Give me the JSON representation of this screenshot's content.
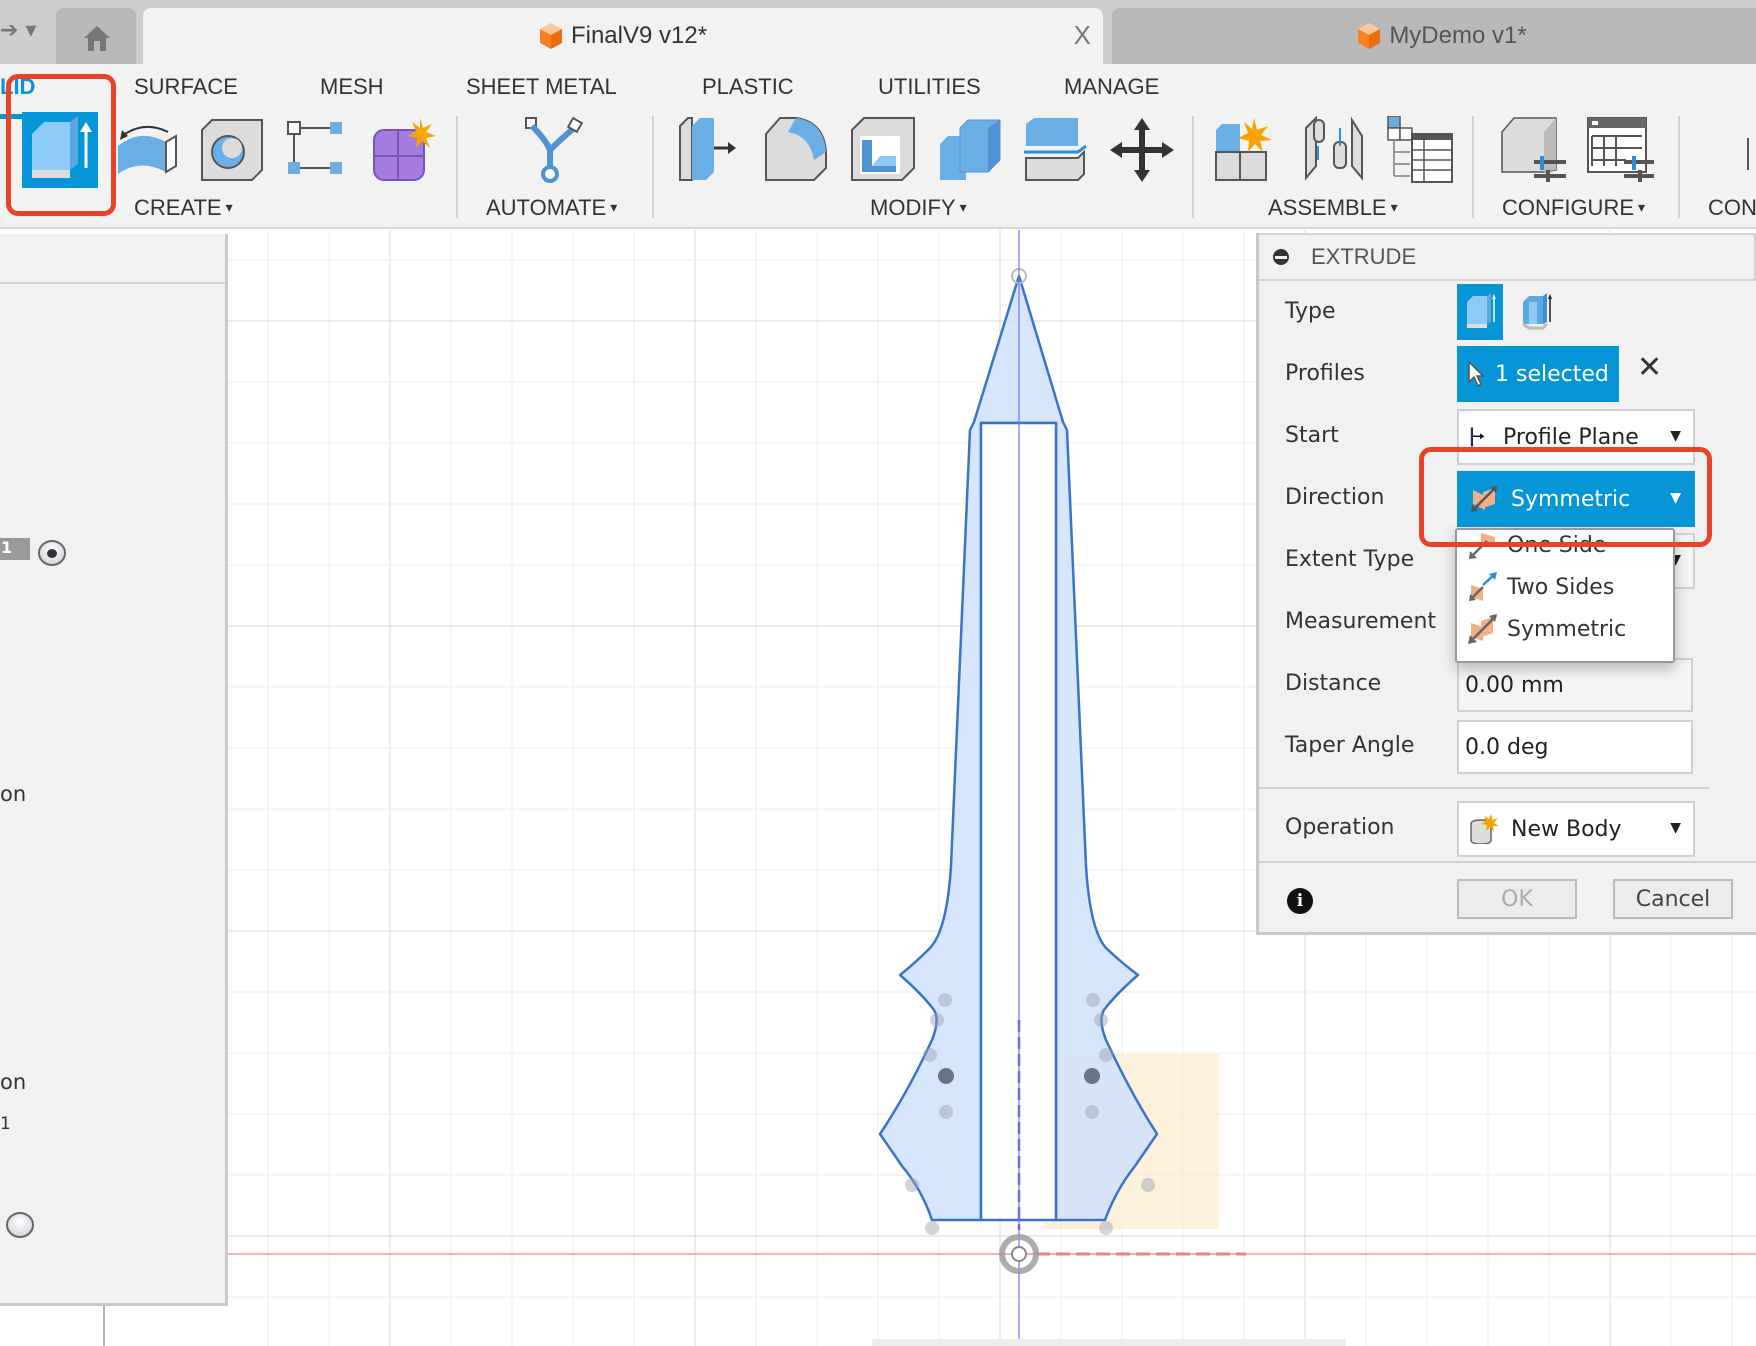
{
  "tabbar": {
    "active_tab": "FinalV9 v12*",
    "inactive_tab": "MyDemo v1*",
    "close_glyph": "X"
  },
  "ribbon": {
    "tabs": [
      "SOLID",
      "SURFACE",
      "MESH",
      "SHEET METAL",
      "PLASTIC",
      "UTILITIES",
      "MANAGE"
    ],
    "active_tab_visible": "LID",
    "groups": [
      "CREATE",
      "AUTOMATE",
      "MODIFY",
      "ASSEMBLE",
      "CONFIGURE",
      "CON"
    ],
    "caret": "▾",
    "create_icons": [
      "extrude-icon",
      "revolve-icon",
      "hole-icon",
      "pattern-icon",
      "form-icon"
    ],
    "automate_icons": [
      "automate-icon"
    ],
    "modify_icons": [
      "press-pull-icon",
      "fillet-icon",
      "shell-icon",
      "combine-icon",
      "split-body-icon",
      "move-icon"
    ],
    "assemble_icons": [
      "new-component-icon",
      "joint-icon",
      "component-table-icon"
    ],
    "configure_icons": [
      "configure-model-icon",
      "configuration-table-icon"
    ]
  },
  "left_panel": {
    "badge": "1",
    "text_on_1": "on",
    "text_on_2": "on",
    "text_1": "1"
  },
  "extrude_panel": {
    "title": "EXTRUDE",
    "rows": {
      "type": {
        "label": "Type",
        "options": [
          "solid-extrude",
          "thin-extrude"
        ],
        "selected": "solid-extrude"
      },
      "profiles": {
        "label": "Profiles",
        "value": "1 selected"
      },
      "start": {
        "label": "Start",
        "value": "Profile Plane"
      },
      "direction": {
        "label": "Direction",
        "value": "Symmetric"
      },
      "extent_type": {
        "label": "Extent Type"
      },
      "measurement": {
        "label": "Measurement"
      },
      "distance": {
        "label": "Distance",
        "value": "0.00 mm"
      },
      "taper_angle": {
        "label": "Taper Angle",
        "value": "0.0 deg"
      },
      "operation": {
        "label": "Operation",
        "value": "New Body"
      }
    },
    "ok_label": "OK",
    "cancel_label": "Cancel",
    "clear_glyph": "✕",
    "info_glyph": "i"
  },
  "direction_menu": {
    "options": [
      "One Side",
      "Two Sides",
      "Symmetric"
    ]
  },
  "colors": {
    "accent": "#0696d7",
    "highlight": "#e8432a",
    "sketch_line": "#3a73c8",
    "sketch_fill": "#cfe2fb"
  }
}
